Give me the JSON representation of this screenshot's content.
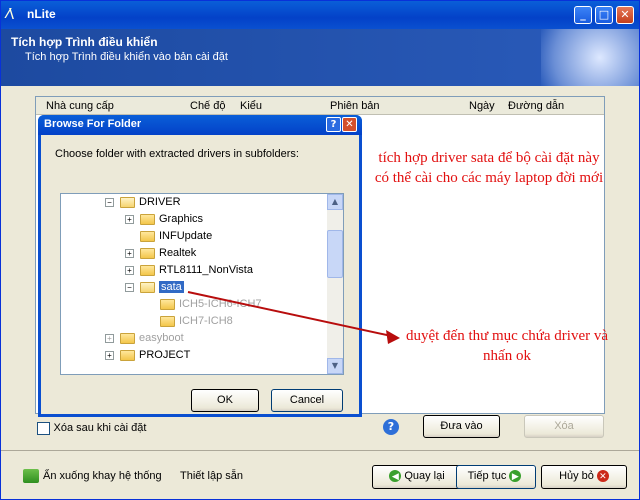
{
  "window": {
    "title": "nLite",
    "header_title": "Tích hợp Trình điều khiển",
    "header_subtitle": "Tích hợp Trình điều khiển vào bản cài đặt"
  },
  "list": {
    "columns": [
      "Nhà cung cấp",
      "Chế độ",
      "Kiểu",
      "Phiên bản",
      "Ngày",
      "Đường dẫn"
    ]
  },
  "annotations": {
    "top_note": "tích hợp driver sata để bộ cài đặt này có thể cài cho các máy laptop đời mới",
    "bottom_note": "duyệt đến thư mục chứa driver và nhấn ok"
  },
  "options": {
    "delete_after_install": "Xóa sau khi cài đặt"
  },
  "buttons": {
    "add": "Đưa vào",
    "delete": "Xóa",
    "back": "Quay lại",
    "next": "Tiếp tục",
    "cancel": "Hủy bỏ",
    "minimize_tray": "Ẩn xuống khay hệ thống",
    "presets": "Thiết lập sẵn"
  },
  "dialog": {
    "title": "Browse For Folder",
    "message": "Choose folder with extracted drivers in subfolders:",
    "ok": "OK",
    "cancel": "Cancel",
    "tree": [
      {
        "label": "DRIVER",
        "expander": "−",
        "state": "normal"
      },
      {
        "label": "Graphics",
        "expander": "+",
        "state": "normal"
      },
      {
        "label": "INFUpdate",
        "expander": "",
        "state": "normal"
      },
      {
        "label": "Realtek",
        "expander": "+",
        "state": "normal"
      },
      {
        "label": "RTL8111_NonVista",
        "expander": "+",
        "state": "normal"
      },
      {
        "label": "sata",
        "expander": "−",
        "state": "selected"
      },
      {
        "label": "ICH5-ICH6-ICH7",
        "expander": "",
        "state": "faded"
      },
      {
        "label": "ICH7-ICH8",
        "expander": "",
        "state": "faded"
      },
      {
        "label": "easyboot",
        "expander": "+",
        "state": "faded"
      },
      {
        "label": "PROJECT",
        "expander": "+",
        "state": "normal"
      }
    ]
  },
  "colors": {
    "xp_blue": "#0a5fd8",
    "annotation_red": "#e21010",
    "selection": "#316ac5"
  }
}
